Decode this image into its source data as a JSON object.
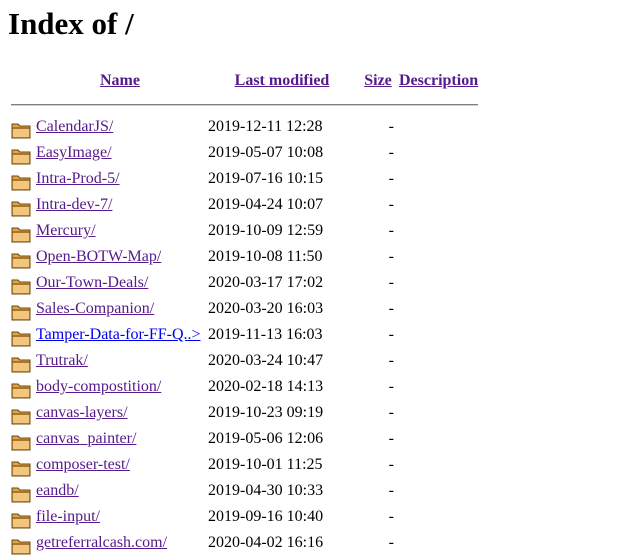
{
  "page": {
    "title": "Index of /"
  },
  "columns": {
    "name": "Name",
    "last_modified": "Last modified",
    "size": "Size",
    "description": "Description"
  },
  "entries": [
    {
      "name": "CalendarJS/",
      "modified": "2019-12-11 12:28",
      "size": "-",
      "visited": true
    },
    {
      "name": "EasyImage/",
      "modified": "2019-05-07 10:08",
      "size": "-",
      "visited": true
    },
    {
      "name": "Intra-Prod-5/",
      "modified": "2019-07-16 10:15",
      "size": "-",
      "visited": true
    },
    {
      "name": "Intra-dev-7/",
      "modified": "2019-04-24 10:07",
      "size": "-",
      "visited": true
    },
    {
      "name": "Mercury/",
      "modified": "2019-10-09 12:59",
      "size": "-",
      "visited": true
    },
    {
      "name": "Open-BOTW-Map/",
      "modified": "2019-10-08 11:50",
      "size": "-",
      "visited": true
    },
    {
      "name": "Our-Town-Deals/",
      "modified": "2020-03-17 17:02",
      "size": "-",
      "visited": true
    },
    {
      "name": "Sales-Companion/",
      "modified": "2020-03-20 16:03",
      "size": "-",
      "visited": true
    },
    {
      "name": "Tamper-Data-for-FF-Q..>",
      "modified": "2019-11-13 16:03",
      "size": "-",
      "visited": false
    },
    {
      "name": "Trutrak/",
      "modified": "2020-03-24 10:47",
      "size": "-",
      "visited": true
    },
    {
      "name": "body-compostition/",
      "modified": "2020-02-18 14:13",
      "size": "-",
      "visited": true
    },
    {
      "name": "canvas-layers/",
      "modified": "2019-10-23 09:19",
      "size": "-",
      "visited": true
    },
    {
      "name": "canvas_painter/",
      "modified": "2019-05-06 12:06",
      "size": "-",
      "visited": true
    },
    {
      "name": "composer-test/",
      "modified": "2019-10-01 11:25",
      "size": "-",
      "visited": true
    },
    {
      "name": "eandb/",
      "modified": "2019-04-30 10:33",
      "size": "-",
      "visited": true
    },
    {
      "name": "file-input/",
      "modified": "2019-09-16 10:40",
      "size": "-",
      "visited": true
    },
    {
      "name": "getreferralcash.com/",
      "modified": "2020-04-02 16:16",
      "size": "-",
      "visited": true
    }
  ]
}
